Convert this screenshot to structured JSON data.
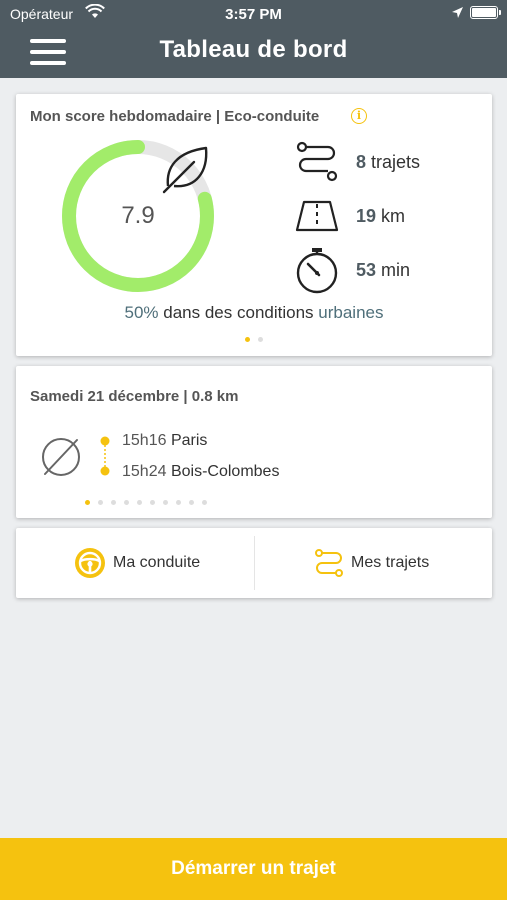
{
  "status_bar": {
    "carrier": "Opérateur",
    "time": "3:57 PM"
  },
  "header": {
    "title": "Tableau de bord"
  },
  "score_card": {
    "title": "Mon score hebdomadaire | Eco-conduite",
    "info_icon": "i",
    "score": "7.9",
    "score_fraction": 0.79,
    "stats": [
      {
        "value": "8",
        "unit": "trajets"
      },
      {
        "value": "19",
        "unit": "km"
      },
      {
        "value": "53",
        "unit": "min"
      }
    ],
    "conditions_pct": "50%",
    "conditions_text": "dans des conditions",
    "conditions_type": "urbaines",
    "page_dots": 2,
    "active_dot": 0
  },
  "trip_card": {
    "title": "Samedi 21 décembre | 0.8 km",
    "start_time": "15h16",
    "start_place": "Paris",
    "end_time": "15h24",
    "end_place": "Bois-Colombes",
    "page_dots": 10,
    "active_dot": 0
  },
  "actions": {
    "driving_label": "Ma conduite",
    "trips_label": "Mes trajets"
  },
  "cta": {
    "label": "Démarrer un trajet"
  },
  "colors": {
    "accent": "#f5c20f",
    "header": "#4f5b62",
    "gauge_fill": "#a2ec6a",
    "gauge_track": "#e6e6e6"
  },
  "icons": {
    "menu": "hamburger-icon",
    "leaf": "leaf-icon",
    "route": "route-icon",
    "road": "road-icon",
    "stopwatch": "stopwatch-icon",
    "no_score": "no-score-icon",
    "steering": "steering-wheel-icon"
  }
}
